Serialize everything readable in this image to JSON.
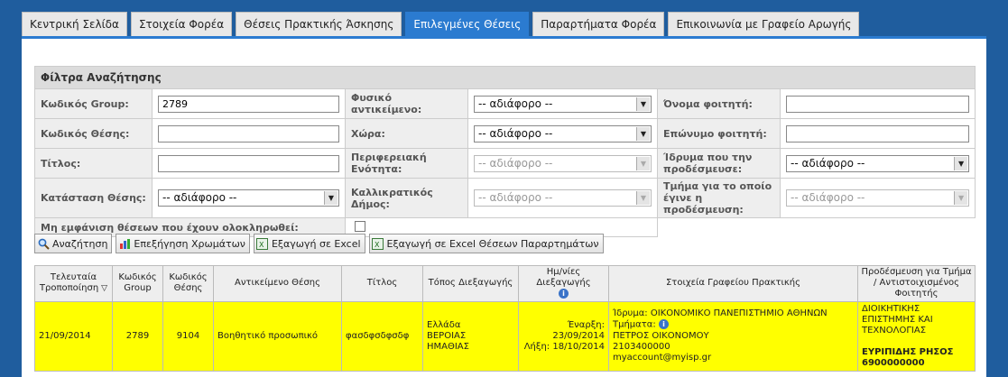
{
  "tabs": [
    {
      "label": "Κεντρική Σελίδα",
      "active": false
    },
    {
      "label": "Στοιχεία Φορέα",
      "active": false
    },
    {
      "label": "Θέσεις Πρακτικής Άσκησης",
      "active": false
    },
    {
      "label": "Επιλεγμένες Θέσεις",
      "active": true
    },
    {
      "label": "Παραρτήματα Φορέα",
      "active": false
    },
    {
      "label": "Επικοινωνία με Γραφείο Αρωγής",
      "active": false
    }
  ],
  "filter": {
    "title": "Φίλτρα Αναζήτησης",
    "group_code_label": "Κωδικός Group:",
    "group_code_value": "2789",
    "position_code_label": "Κωδικός Θέσης:",
    "position_code_value": "",
    "title_label": "Τίτλος:",
    "title_value": "",
    "status_label": "Κατάσταση Θέσης:",
    "status_value": "-- αδιάφορο --",
    "physical_object_label": "Φυσικό αντικείμενο:",
    "physical_object_value": "-- αδιάφορο --",
    "country_label": "Χώρα:",
    "country_value": "-- αδιάφορο --",
    "region_label": "Περιφερειακή Ενότητα:",
    "region_value": "-- αδιάφορο --",
    "municipality_label": "Καλλικρατικός Δήμος:",
    "municipality_value": "-- αδιάφορο --",
    "student_name_label": "Όνομα φοιτητή:",
    "student_name_value": "",
    "student_surname_label": "Επώνυμο φοιτητή:",
    "student_surname_value": "",
    "institution_label": "Ίδρυμα που την προδέσμευσε:",
    "institution_value": "-- αδιάφορο --",
    "department_label": "Τμήμα για το οποίο έγινε η προδέσμευση:",
    "department_value": "-- αδιάφορο --",
    "hide_completed_label": "Μη εμφάνιση θέσεων που έχουν ολοκληρωθεί:"
  },
  "buttons": {
    "search": "Αναζήτηση",
    "colors": "Επεξήγηση Χρωμάτων",
    "excel": "Εξαγωγή σε Excel",
    "excel_annex": "Εξαγωγή σε Excel Θέσεων Παραρτημάτων"
  },
  "table": {
    "headers": {
      "last_modified": "Τελευταία Τροποποίηση",
      "group_code": "Κωδικός Group",
      "position_code": "Κωδικός Θέσης",
      "object": "Αντικείμενο Θέσης",
      "title": "Τίτλος",
      "place": "Τόπος Διεξαγωγής",
      "dates": "Ημ/νίες Διεξαγωγής",
      "office": "Στοιχεία Γραφείου Πρακτικής",
      "assignment": "Προδέσμευση για Τμήμα / Αντιστοιχισμένος Φοιτητής"
    },
    "row": {
      "last_modified": "21/09/2014",
      "group_code": "2789",
      "position_code": "9104",
      "object": "Βοηθητικό προσωπικό",
      "title": "φασδφσδφσδφ",
      "place_country": "Ελλάδα",
      "place_city": "ΒΕΡΟΙΑΣ",
      "place_region": "ΗΜΑΘΙΑΣ",
      "start_label": "Έναρξη:",
      "start_date": "23/09/2014",
      "end_label": "Λήξη:",
      "end_date": "18/10/2014",
      "office_institution": "Ίδρυμα: ΟΙΚΟΝΟΜΙΚΟ ΠΑΝΕΠΙΣΤΗΜΙΟ ΑΘΗΝΩΝ",
      "office_departments_label": "Τμήματα:",
      "office_person": "ΠΕΤΡΟΣ ΟΙΚΟΝΟΜΟΥ",
      "office_phone": "2103400000",
      "office_email": "myaccount@myisp.gr",
      "assignment_department": "ΔΙΟΙΚΗΤΙΚΗΣ ΕΠΙΣΤΗΜΗΣ ΚΑΙ ΤΕΧΝΟΛΟΓΙΑΣ",
      "assignment_student": "ΕΥΡΙΠΙΔΗΣ ΡΗΣΟΣ",
      "assignment_code": "6900000000"
    }
  },
  "colors": {
    "header_blue": "#1f5d9e",
    "active_tab": "#2b7bd0",
    "row_highlight": "#ffff00"
  }
}
